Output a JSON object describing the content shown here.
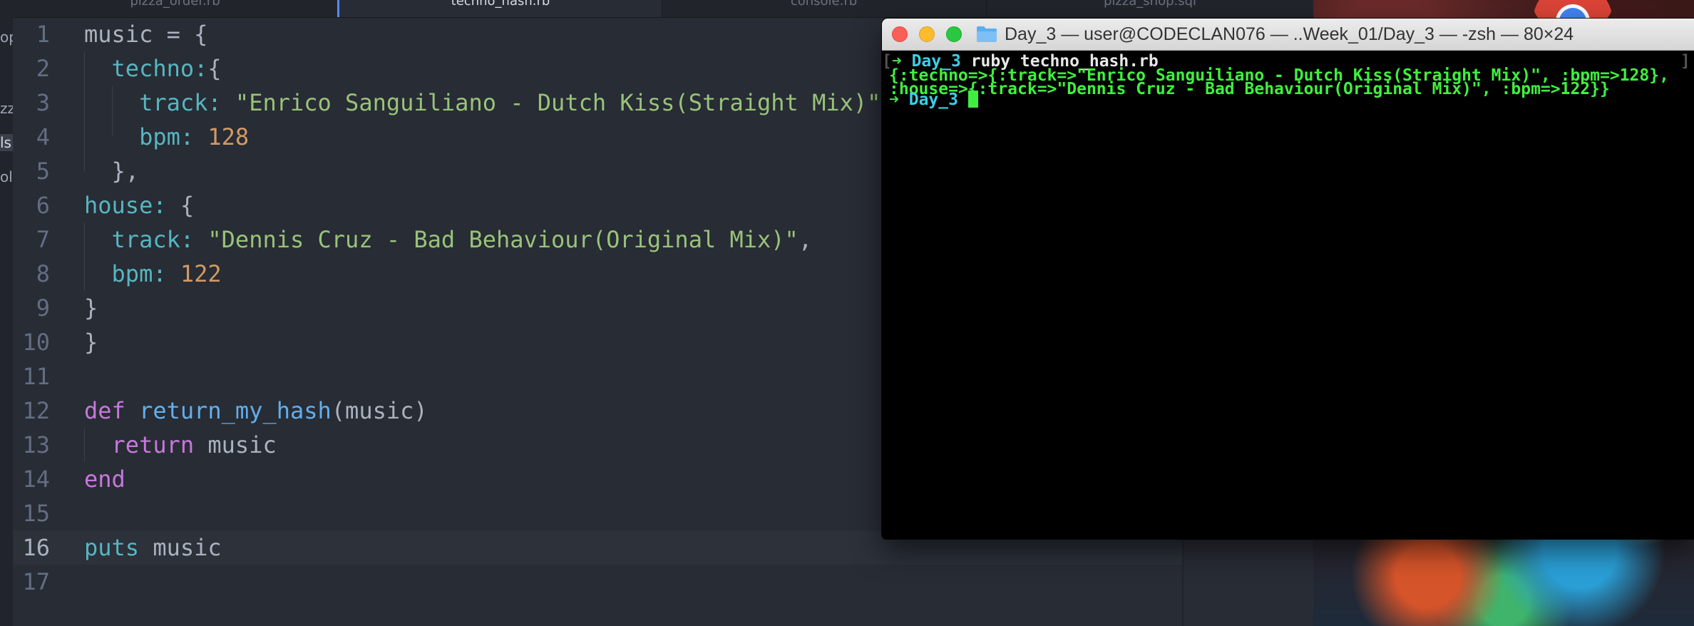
{
  "sidebar_fragments": [
    "op",
    "zz",
    "ls",
    "ole"
  ],
  "editor": {
    "tabs": [
      "pizza_order.rb",
      "techno_hash.rb",
      "console.rb",
      "pizza_shop.sql"
    ],
    "active_tab_index": 1,
    "line_numbers": [
      "1",
      "2",
      "3",
      "4",
      "5",
      "6",
      "7",
      "8",
      "9",
      "10",
      "11",
      "12",
      "13",
      "14",
      "15",
      "16",
      "17"
    ],
    "lines": [
      [
        {
          "c": "k-plain",
          "t": "music = {"
        }
      ],
      [
        {
          "c": "k-plain",
          "t": "  "
        },
        {
          "c": "k-sym",
          "t": "techno:"
        },
        {
          "c": "k-plain",
          "t": "{"
        }
      ],
      [
        {
          "c": "k-plain",
          "t": "    "
        },
        {
          "c": "k-sym",
          "t": "track:"
        },
        {
          "c": "k-plain",
          "t": " "
        },
        {
          "c": "k-str",
          "t": "\"Enrico Sanguiliano - Dutch Kiss(Straight Mix)\""
        }
      ],
      [
        {
          "c": "k-plain",
          "t": "    "
        },
        {
          "c": "k-sym",
          "t": "bpm:"
        },
        {
          "c": "k-plain",
          "t": " "
        },
        {
          "c": "k-num",
          "t": "128"
        }
      ],
      [
        {
          "c": "k-plain",
          "t": "  },"
        }
      ],
      [
        {
          "c": "k-sym",
          "t": "house:"
        },
        {
          "c": "k-plain",
          "t": " {"
        }
      ],
      [
        {
          "c": "k-plain",
          "t": "  "
        },
        {
          "c": "k-sym",
          "t": "track:"
        },
        {
          "c": "k-plain",
          "t": " "
        },
        {
          "c": "k-str",
          "t": "\"Dennis Cruz - Bad Behaviour(Original Mix)\""
        },
        {
          "c": "k-plain",
          "t": ","
        }
      ],
      [
        {
          "c": "k-plain",
          "t": "  "
        },
        {
          "c": "k-sym",
          "t": "bpm:"
        },
        {
          "c": "k-plain",
          "t": " "
        },
        {
          "c": "k-num",
          "t": "122"
        }
      ],
      [
        {
          "c": "k-plain",
          "t": "}"
        }
      ],
      [
        {
          "c": "k-plain",
          "t": "}"
        }
      ],
      [],
      [
        {
          "c": "k-kw",
          "t": "def"
        },
        {
          "c": "k-plain",
          "t": " "
        },
        {
          "c": "k-fn",
          "t": "return_my_hash"
        },
        {
          "c": "k-plain",
          "t": "(music)"
        }
      ],
      [
        {
          "c": "k-plain",
          "t": "  "
        },
        {
          "c": "k-kw",
          "t": "return"
        },
        {
          "c": "k-plain",
          "t": " music"
        }
      ],
      [
        {
          "c": "k-kw",
          "t": "end"
        }
      ],
      [],
      [
        {
          "c": "k-builtin",
          "t": "puts"
        },
        {
          "c": "k-plain",
          "t": " music"
        }
      ],
      []
    ],
    "current_line": 16
  },
  "terminal": {
    "title": "Day_3 — user@CODECLAN076 — ..Week_01/Day_3 — -zsh — 80×24",
    "prompt_arrow": "➜",
    "prompt_dir": "Day_3",
    "command": "ruby techno_hash.rb",
    "output": [
      "{:techno=>{:track=>\"Enrico Sanguiliano - Dutch Kiss(Straight Mix)\", :bpm=>128},",
      ":house=>{:track=>\"Dennis Cruz - Bad Behaviour(Original Mix)\", :bpm=>122}}"
    ],
    "left_bracket": "[",
    "right_bracket": "]"
  },
  "colors": {
    "editor_bg": "#282c34",
    "terminal_bg": "#000000",
    "terminal_green": "#3ff03f",
    "terminal_cyan": "#3ad0e6",
    "tab_accent": "#568af2"
  }
}
